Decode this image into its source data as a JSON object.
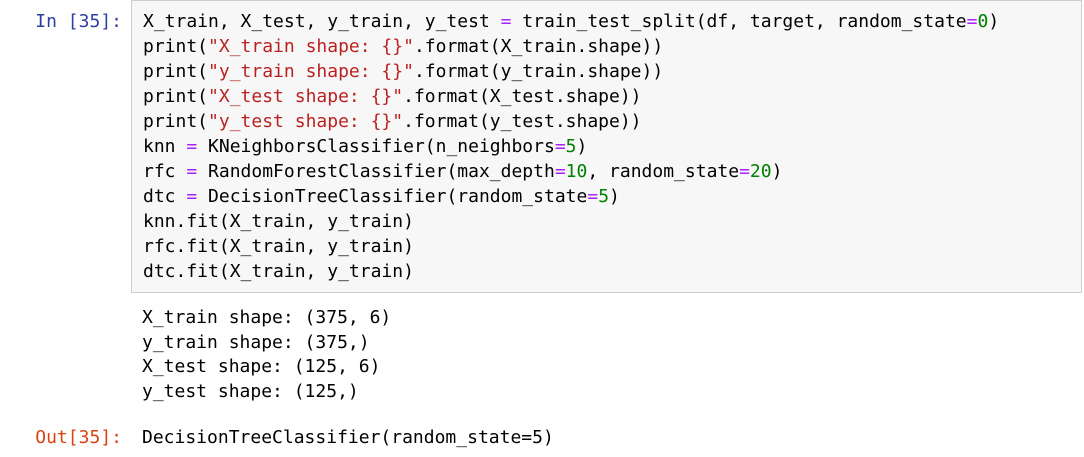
{
  "cell": {
    "in_prompt": "In [35]:",
    "out_prompt": "Out[35]:"
  },
  "code_lines": [
    [
      {
        "t": "X_train, X_test, y_train, y_test "
      },
      {
        "t": "=",
        "c": "op"
      },
      {
        "t": " train_test_split(df, target, random_state"
      },
      {
        "t": "=",
        "c": "op"
      },
      {
        "t": "0",
        "c": "num"
      },
      {
        "t": ")"
      }
    ],
    [
      {
        "t": "print("
      },
      {
        "t": "\"X_train shape: {}\"",
        "c": "str"
      },
      {
        "t": ".format(X_train.shape))"
      }
    ],
    [
      {
        "t": "print("
      },
      {
        "t": "\"y_train shape: {}\"",
        "c": "str"
      },
      {
        "t": ".format(y_train.shape))"
      }
    ],
    [
      {
        "t": "print("
      },
      {
        "t": "\"X_test shape: {}\"",
        "c": "str"
      },
      {
        "t": ".format(X_test.shape))"
      }
    ],
    [
      {
        "t": "print("
      },
      {
        "t": "\"y_test shape: {}\"",
        "c": "str"
      },
      {
        "t": ".format(y_test.shape))"
      }
    ],
    [
      {
        "t": "knn "
      },
      {
        "t": "=",
        "c": "op"
      },
      {
        "t": " KNeighborsClassifier(n_neighbors"
      },
      {
        "t": "=",
        "c": "op"
      },
      {
        "t": "5",
        "c": "num"
      },
      {
        "t": ")"
      }
    ],
    [
      {
        "t": "rfc "
      },
      {
        "t": "=",
        "c": "op"
      },
      {
        "t": " RandomForestClassifier(max_depth"
      },
      {
        "t": "=",
        "c": "op"
      },
      {
        "t": "10",
        "c": "num"
      },
      {
        "t": ", random_state"
      },
      {
        "t": "=",
        "c": "op"
      },
      {
        "t": "20",
        "c": "num"
      },
      {
        "t": ")"
      }
    ],
    [
      {
        "t": "dtc "
      },
      {
        "t": "=",
        "c": "op"
      },
      {
        "t": " DecisionTreeClassifier(random_state"
      },
      {
        "t": "=",
        "c": "op"
      },
      {
        "t": "5",
        "c": "num"
      },
      {
        "t": ")"
      }
    ],
    [
      {
        "t": "knn.fit(X_train, y_train)"
      }
    ],
    [
      {
        "t": "rfc.fit(X_train, y_train)"
      }
    ],
    [
      {
        "t": "dtc.fit(X_train, y_train)"
      }
    ]
  ],
  "stdout_lines": [
    "X_train shape: (375, 6)",
    "y_train shape: (375,)",
    "X_test shape: (125, 6)",
    "y_test shape: (125,)"
  ],
  "result": "DecisionTreeClassifier(random_state=5)",
  "colors": {
    "in_prompt": "#303f9f",
    "out_prompt": "#d84315",
    "string": "#ba2121",
    "number": "#008000",
    "operator": "#aa22ff",
    "cell_background": "#f7f7f7",
    "cell_border": "#cfcfcf"
  }
}
